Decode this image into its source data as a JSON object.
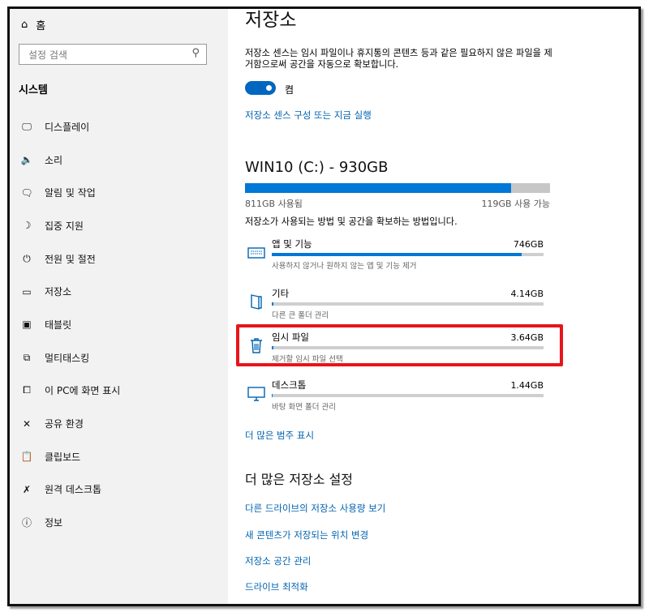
{
  "sidebar": {
    "home_label": "홈",
    "search_placeholder": "설정 검색",
    "section_title": "시스템",
    "items": [
      {
        "icon": "monitor-icon",
        "glyph": "🖵",
        "label": "디스플레이"
      },
      {
        "icon": "speaker-icon",
        "glyph": "🔈",
        "label": "소리"
      },
      {
        "icon": "notification-icon",
        "glyph": "🗨",
        "label": "알림 및 작업"
      },
      {
        "icon": "moon-icon",
        "glyph": "☽",
        "label": "집중 지원"
      },
      {
        "icon": "power-icon",
        "glyph": "⏻",
        "label": "전원 및 절전"
      },
      {
        "icon": "drive-icon",
        "glyph": "▭",
        "label": "저장소"
      },
      {
        "icon": "tablet-icon",
        "glyph": "▣",
        "label": "태블릿"
      },
      {
        "icon": "multitask-icon",
        "glyph": "⧉",
        "label": "멀티태스킹"
      },
      {
        "icon": "project-icon",
        "glyph": "⧠",
        "label": "이 PC에 화면 표시"
      },
      {
        "icon": "share-icon",
        "glyph": "✕",
        "label": "공유 환경"
      },
      {
        "icon": "clipboard-icon",
        "glyph": "📋",
        "label": "클립보드"
      },
      {
        "icon": "remote-desktop-icon",
        "glyph": "✗",
        "label": "원격 데스크톱"
      },
      {
        "icon": "info-icon",
        "glyph": "ⓘ",
        "label": "정보"
      }
    ]
  },
  "main": {
    "title": "저장소",
    "storage_sense_desc": "저장소 센스는 임시 파일이나 휴지통의 콘텐츠 등과 같은 필요하지 않은 파일을 제거함으로써 공간을 자동으로 확보합니다.",
    "toggle_label": "켬",
    "toggle_on": true,
    "configure_link": "저장소 센스 구성 또는 지금 실행",
    "drive": {
      "title": "WIN10 (C:) - 930GB",
      "used_label": "811GB 사용됨",
      "available_label": "119GB 사용 가능",
      "used_fraction": 0.872
    },
    "how_text": "저장소가 사용되는 방법 및 공간을 확보하는 방법입니다.",
    "categories": [
      {
        "icon": "apps-icon",
        "name": "앱 및 기능",
        "size": "746GB",
        "desc": "사용하지 않거나 원하지 않는 앱 및 기능 제거",
        "fraction": 0.92
      },
      {
        "icon": "other-icon",
        "name": "기타",
        "size": "4.14GB",
        "desc": "다른 큰 폴더 관리",
        "fraction": 0.006
      },
      {
        "icon": "trash-icon",
        "name": "임시 파일",
        "size": "3.64GB",
        "desc": "제거할 임시 파일 선택",
        "fraction": 0.005
      },
      {
        "icon": "desktop-icon",
        "name": "데스크톱",
        "size": "1.44GB",
        "desc": "바탕 화면 폴더 관리",
        "fraction": 0.003
      }
    ],
    "more_categories_link": "더 많은 범주 표시",
    "more_settings_title": "더 많은 저장소 설정",
    "more_links": [
      "다른 드라이브의 저장소 사용량 보기",
      "새 콘텐츠가 저장되는 위치 변경",
      "저장소 공간 관리",
      "드라이브 최적화"
    ]
  },
  "colors": {
    "accent": "#0078d7",
    "link": "#0063b1",
    "highlight": "#e8141b",
    "sidebar_bg": "#f2f2f2"
  }
}
